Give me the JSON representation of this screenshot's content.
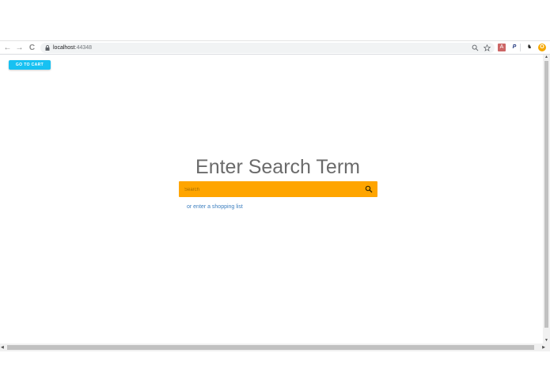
{
  "browser": {
    "url_host": "localhost",
    "url_port": ":44348",
    "nav": {
      "back": "←",
      "forward": "→",
      "reload": "C"
    }
  },
  "page": {
    "cart_button": "GO TO CART",
    "heading": "Enter Search Term",
    "search": {
      "placeholder": "Search",
      "value": ""
    },
    "shopping_list_link": "or enter a shopping list"
  },
  "colors": {
    "accent": "#17c1f2",
    "search_bar": "#ffa500",
    "link": "#3d7fbf"
  }
}
